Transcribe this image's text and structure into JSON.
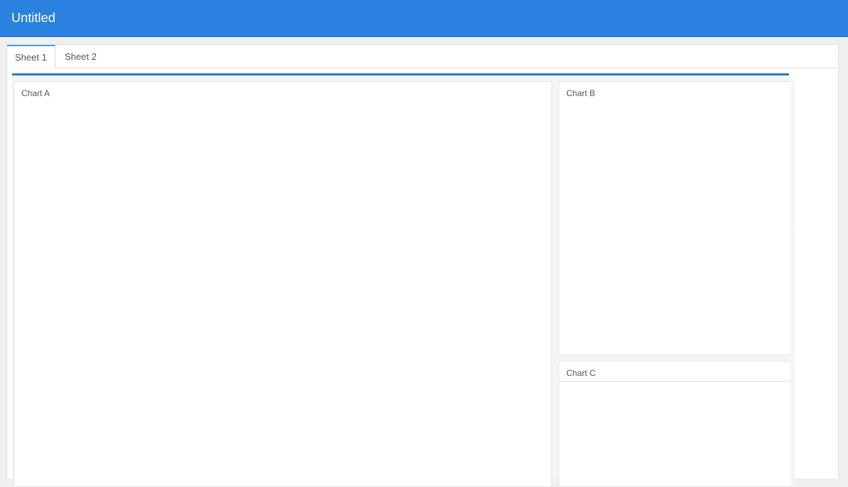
{
  "header": {
    "title": "Untitled",
    "background_color": "#2b81e0"
  },
  "tabs": [
    {
      "label": "Sheet 1",
      "active": true
    },
    {
      "label": "Sheet 2",
      "active": false
    }
  ],
  "dashboard": {
    "accent_color": "#2b7bd0",
    "panels": {
      "a": {
        "title": "Chart A"
      },
      "b": {
        "title": "Chart B"
      },
      "c": {
        "title": "Chart C"
      }
    }
  }
}
